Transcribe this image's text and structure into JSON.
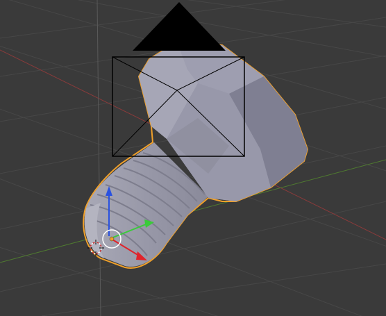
{
  "viewport": {
    "background": "#3a3a3a",
    "grid_color": "#474747",
    "x_axis_color": "#8a3a3a",
    "y_axis_color": "#4f7a30",
    "z_axis_color": "#5a5a5a"
  },
  "object": {
    "type": "screw / bolt mesh",
    "selected": true,
    "outline_color": "#f0a02a",
    "body_color": "#9a9aab",
    "head_color": "#8a8a9c"
  },
  "camera": {
    "icon": "camera-icon",
    "frame_color": "#000000",
    "triangle_color": "#000000"
  },
  "gizmo": {
    "x_color": "#e0232b",
    "y_color": "#3acb3a",
    "z_color": "#2a52e0"
  },
  "cursor_3d": {
    "icon": "3d-cursor-icon"
  },
  "origin": {
    "color": "#f0a02a"
  }
}
